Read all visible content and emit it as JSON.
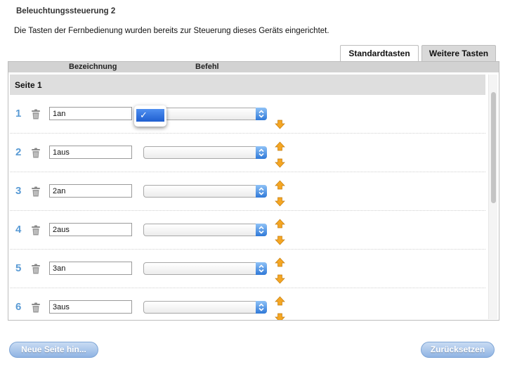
{
  "header": {
    "title": "Beleuchtungssteuerung 2",
    "subtitle": "Die Tasten der Fernbedienung wurden bereits zur Steuerung dieses Geräts eingerichtet."
  },
  "tabs": [
    {
      "label": "Standardtasten",
      "active": false
    },
    {
      "label": "Weitere Tasten",
      "active": true
    }
  ],
  "columns": {
    "bezeichnung": "Bezeichnung",
    "befehl": "Befehl"
  },
  "page": {
    "label": "Seite 1"
  },
  "rows": [
    {
      "number": "1",
      "name": "1an",
      "command": ""
    },
    {
      "number": "2",
      "name": "1aus",
      "command": ""
    },
    {
      "number": "3",
      "name": "2an",
      "command": ""
    },
    {
      "number": "4",
      "name": "2aus",
      "command": ""
    },
    {
      "number": "5",
      "name": "3an",
      "command": ""
    },
    {
      "number": "6",
      "name": "3aus",
      "command": ""
    }
  ],
  "dropdown": {
    "selected_mark": "✓",
    "open_row": 1
  },
  "buttons": {
    "new_page": "Neue Seite hin...",
    "reset": "Zurücksetzen"
  },
  "colors": {
    "accent_blue": "#5a9bd5",
    "select_button": "#2f79d8",
    "arrow_orange": "#f5a623"
  },
  "icons": {
    "trash": "trash-icon",
    "move_up": "arrow-up-icon",
    "move_down": "arrow-down-icon",
    "select": "select-chevrons-icon"
  }
}
